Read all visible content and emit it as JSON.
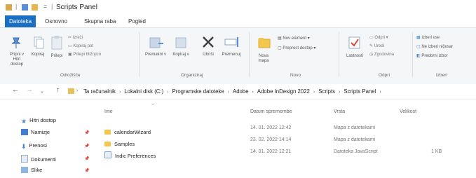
{
  "window": {
    "title": "Scripts Panel"
  },
  "ribbon_tabs": [
    "Datoteka",
    "Osnovno",
    "Skupna raba",
    "Pogled"
  ],
  "ribbon": {
    "clipboard": {
      "group_label": "Odložišče",
      "pin": "Pripni v Hitri dostop",
      "copy": "Kopiraj",
      "paste": "Prilepi",
      "cut": "Izreži",
      "copy_path": "Kopiraj pot",
      "paste_shortcut": "Prilepi bližnjico"
    },
    "organize": {
      "group_label": "Organiziraj",
      "move_to": "Premakni v",
      "copy_to": "Kopiraj v",
      "delete": "Izbriši",
      "rename": "Preimenuj"
    },
    "new": {
      "group_label": "Novo",
      "new_folder": "Nova mapa",
      "new_item": "Nov element",
      "easy_access": "Preprost dostop"
    },
    "open": {
      "group_label": "Odpri",
      "properties": "Lastnosti",
      "open": "Odpri",
      "edit": "Uredi",
      "history": "Zgodovina"
    },
    "select": {
      "group_label": "Izberi",
      "select_all": "Izberi vse",
      "select_none": "Ne izberi ničesar",
      "invert": "Preobrni izbor"
    }
  },
  "address": {
    "crumbs": [
      "Ta računalnik",
      "Lokalni disk (C:)",
      "Programske datoteke",
      "Adobe",
      "Adobe InDesign 2022",
      "Scripts",
      "Scripts Panel"
    ]
  },
  "nav_pane": [
    {
      "label": "Hitri dostop",
      "icon": "star-icon",
      "pinned": false
    },
    {
      "label": "Namizje",
      "icon": "desktop-icon",
      "pinned": true
    },
    {
      "label": "Prenosi",
      "icon": "download-icon",
      "pinned": true
    },
    {
      "label": "Dokumenti",
      "icon": "document-icon",
      "pinned": true
    },
    {
      "label": "Slike",
      "icon": "pictures-icon",
      "pinned": true
    }
  ],
  "columns": [
    "Ime",
    "Datum spremembe",
    "Vrsta",
    "Velikost"
  ],
  "files": [
    {
      "name": "calendarWizard",
      "date": "14. 01. 2022 12:42",
      "type": "Mapa z datotekami",
      "size": ""
    },
    {
      "name": "Samples",
      "date": "23. 02. 2022 14:14",
      "type": "Mapa z datotekami",
      "size": ""
    },
    {
      "name": "Indic Preferences",
      "date": "14. 01. 2022 12:21",
      "type": "Datoteka JavaScript",
      "size": "1 KB"
    }
  ]
}
